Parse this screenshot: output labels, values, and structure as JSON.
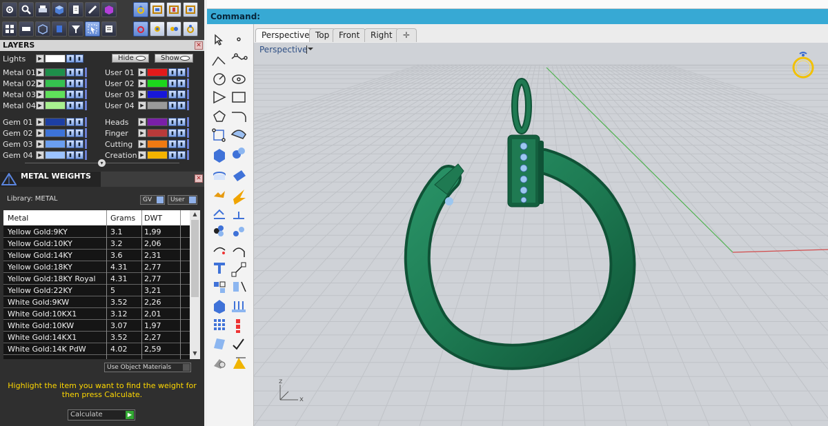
{
  "layers": {
    "title": "LAYERS",
    "lights_label": "Lights",
    "hide_label": "Hide",
    "show_label": "Show",
    "left": [
      {
        "name": "Metal 01",
        "color": "#1e8f4a"
      },
      {
        "name": "Metal 02",
        "color": "#35c24f"
      },
      {
        "name": "Metal 03",
        "color": "#5fe05a"
      },
      {
        "name": "Metal 04",
        "color": "#a8f08f"
      },
      {
        "name": "Gem 01",
        "color": "#1d3fa3"
      },
      {
        "name": "Gem 02",
        "color": "#3d73d8"
      },
      {
        "name": "Gem 03",
        "color": "#6a9ef0"
      },
      {
        "name": "Gem 04",
        "color": "#9cc3ff"
      }
    ],
    "right": [
      {
        "name": "User 01",
        "color": "#e31a1a"
      },
      {
        "name": "User 02",
        "color": "#1cd61c"
      },
      {
        "name": "User 03",
        "color": "#1717d9"
      },
      {
        "name": "User 04",
        "color": "#9a9a9a"
      },
      {
        "name": "Heads",
        "color": "#7a1fa8"
      },
      {
        "name": "Finger",
        "color": "#b83a3a"
      },
      {
        "name": "Cutting",
        "color": "#f07a12"
      },
      {
        "name": "Creation",
        "color": "#f5b400"
      }
    ]
  },
  "metal_weights": {
    "title": "METAL WEIGHTS",
    "library_label": "Library: METAL",
    "gv_label": "GV",
    "user_label": "User",
    "columns": [
      "Metal",
      "Grams",
      "DWT"
    ],
    "rows": [
      [
        "Yellow Gold:9KY",
        "3.1",
        "1,99"
      ],
      [
        "Yellow Gold:10KY",
        "3.2",
        "2,06"
      ],
      [
        "Yellow Gold:14KY",
        "3.6",
        "2,31"
      ],
      [
        "Yellow Gold:18KY",
        "4.31",
        "2,77"
      ],
      [
        "Yellow Gold:18KY Royal",
        "4.31",
        "2,77"
      ],
      [
        "Yellow Gold:22KY",
        "5",
        "3,21"
      ],
      [
        "White Gold:9KW",
        "3.52",
        "2,26"
      ],
      [
        "White Gold:10KX1",
        "3.12",
        "2,01"
      ],
      [
        "White Gold:10KW",
        "3.07",
        "1,97"
      ],
      [
        "White Gold:14KX1",
        "3.52",
        "2,27"
      ],
      [
        "White Gold:14K PdW",
        "4.02",
        "2,59"
      ]
    ],
    "use_object_materials": "Use Object Materials",
    "hint": "Highlight the item you want to find the weight for then press Calculate.",
    "calculate_label": "Calculate"
  },
  "command": {
    "label": "Command:"
  },
  "viewport": {
    "tabs": [
      "Perspective",
      "Top",
      "Front",
      "Right"
    ],
    "add_tab": "✛",
    "active_tab": "Perspective",
    "label": "Perspective",
    "axis_z": "z",
    "axis_x": "x",
    "model_color": "#1f7a52",
    "gem_color": "#9cc7f0"
  }
}
